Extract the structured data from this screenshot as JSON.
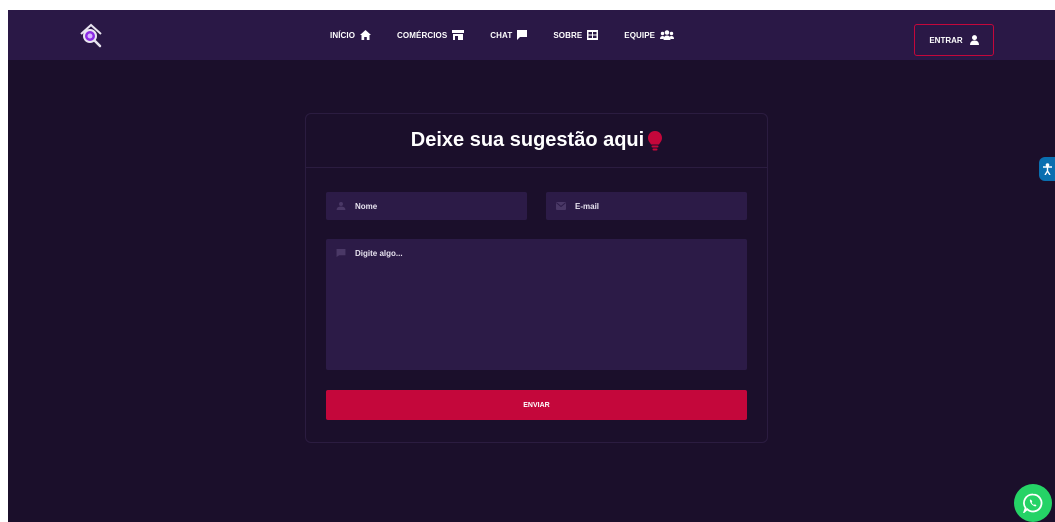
{
  "nav": {
    "links": [
      {
        "label": "INÍCIO",
        "icon": "home-icon"
      },
      {
        "label": "COMÉRCIOS",
        "icon": "store-icon"
      },
      {
        "label": "CHAT",
        "icon": "chat-icon"
      },
      {
        "label": "SOBRE",
        "icon": "grid-icon"
      },
      {
        "label": "EQUIPE",
        "icon": "users-icon"
      }
    ],
    "login_label": "ENTRAR",
    "login_icon": "user-icon"
  },
  "form": {
    "title": "Deixe sua sugestão aqui",
    "title_icon": "lightbulb-icon",
    "name_placeholder": "Nome",
    "email_placeholder": "E-mail",
    "message_placeholder": "Digite algo...",
    "submit_label": "ENVIAR"
  },
  "floating": {
    "accessibility_icon": "accessibility-icon",
    "whatsapp_icon": "whatsapp-icon"
  },
  "colors": {
    "background": "#1b0f2b",
    "navbar": "#2a1846",
    "field": "#2c1b47",
    "accent": "#c4073b",
    "whatsapp": "#25d366",
    "accessibility": "#0a6fb0"
  }
}
